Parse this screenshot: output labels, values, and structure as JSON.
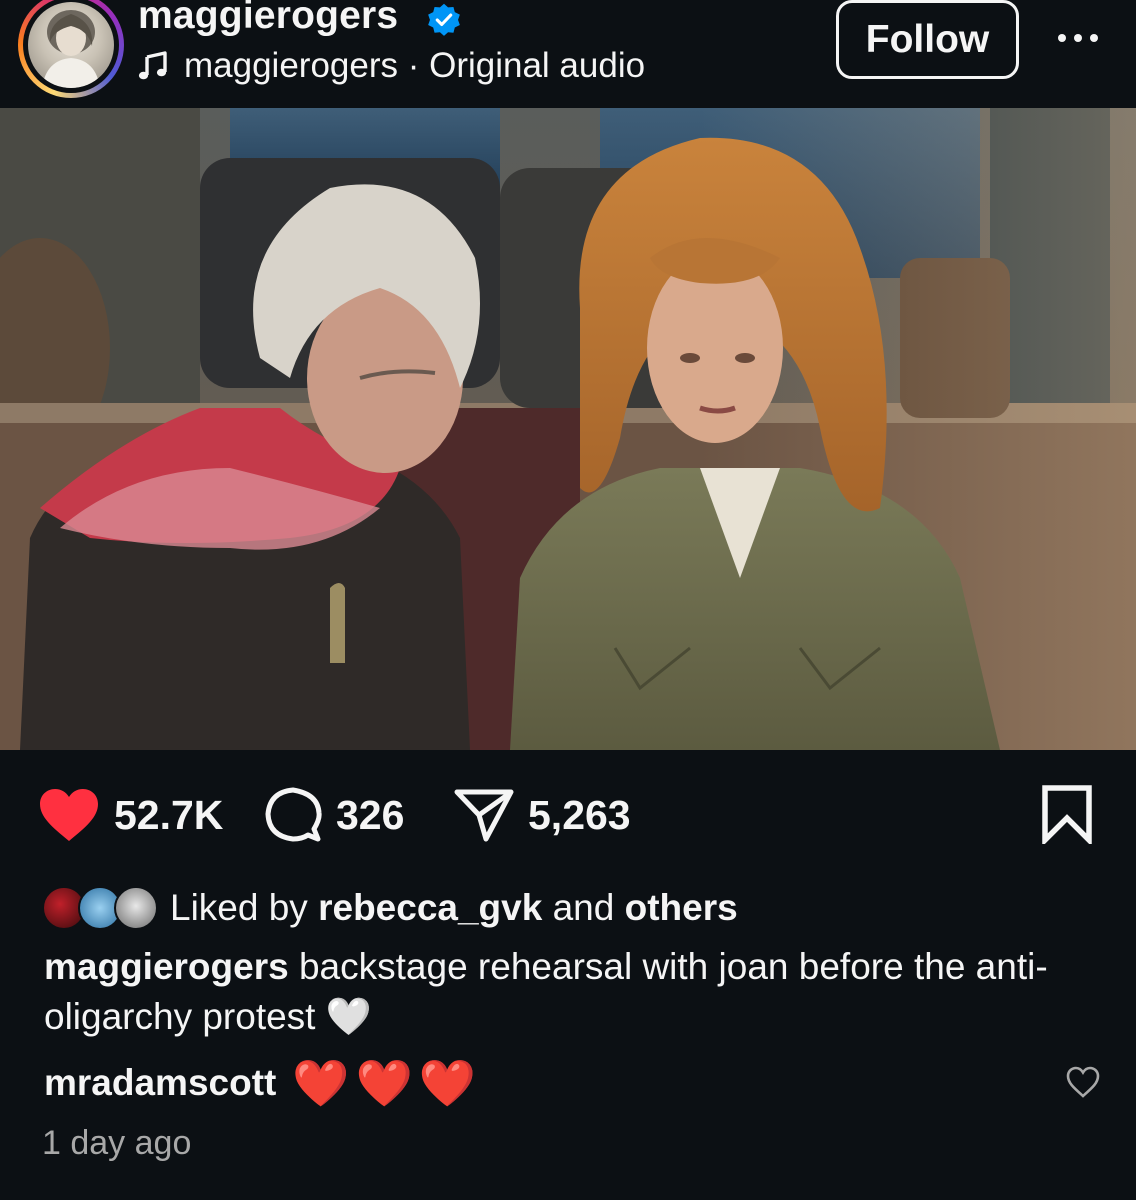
{
  "header": {
    "username": "maggierogers",
    "verified": true,
    "audio_artist": "maggierogers",
    "audio_separator": " · ",
    "audio_title": "Original audio",
    "follow_label": "Follow",
    "more_icon": "more-horizontal-icon"
  },
  "video": {
    "user_tag_icon": "person-icon",
    "mute_icon": "speaker-muted-icon"
  },
  "actions": {
    "likes": "52.7K",
    "comments": "326",
    "shares": "5,263",
    "like_icon": "heart-filled-icon",
    "comment_icon": "comment-bubble-icon",
    "share_icon": "send-icon",
    "save_icon": "bookmark-icon"
  },
  "likes_summary": {
    "prefix": "Liked by",
    "user": "rebecca_gvk",
    "middle": "and",
    "others": "others"
  },
  "caption": {
    "author": "maggierogers",
    "text": "backstage rehearsal with joan before the anti-oligarchy protest",
    "emoji": "🤍"
  },
  "comment": {
    "author": "mradamscott",
    "text": "❤️❤️❤️"
  },
  "timestamp": "1 day ago",
  "colors": {
    "background": "#0c1014",
    "like_red": "#ff3040",
    "verified_blue": "#0095f6",
    "secondary_text": "#a8a8a8"
  }
}
